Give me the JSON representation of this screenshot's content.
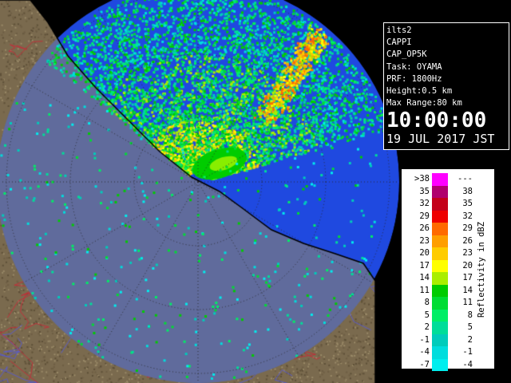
{
  "info": {
    "site": "ilts2",
    "product": "CAPPI",
    "product_code": "CAP_OP5K",
    "task": "Task: OYAMA",
    "prf": "PRF: 1800Hz",
    "height": "Height:0.5 km",
    "max_range": "Max Range:80 km",
    "time": "10:00:00",
    "date": "19 JUL 2017 JST"
  },
  "legend": {
    "unit_label": "Reflectivity in dBZ",
    "rows": [
      {
        "lo": ">38",
        "hi": "---",
        "color": "#ff00ff"
      },
      {
        "lo": "35",
        "hi": "38",
        "color": "#b0006e"
      },
      {
        "lo": "32",
        "hi": "35",
        "color": "#c4001a"
      },
      {
        "lo": "29",
        "hi": "32",
        "color": "#ee0000"
      },
      {
        "lo": "26",
        "hi": "29",
        "color": "#ff6a00"
      },
      {
        "lo": "23",
        "hi": "26",
        "color": "#ff9e00"
      },
      {
        "lo": "20",
        "hi": "23",
        "color": "#ffcc00"
      },
      {
        "lo": "17",
        "hi": "20",
        "color": "#ffff00"
      },
      {
        "lo": "14",
        "hi": "17",
        "color": "#aaee00"
      },
      {
        "lo": "11",
        "hi": "14",
        "color": "#00cc00"
      },
      {
        "lo": "8",
        "hi": "11",
        "color": "#00dd33"
      },
      {
        "lo": "5",
        "hi": "8",
        "color": "#00ee66"
      },
      {
        "lo": "2",
        "hi": "5",
        "color": "#00dd99"
      },
      {
        "lo": "-1",
        "hi": "2",
        "color": "#00ccbb"
      },
      {
        "lo": "-4",
        "hi": "-1",
        "color": "#00dddd"
      },
      {
        "lo": "-7",
        "hi": "-4",
        "color": "#00eeee"
      }
    ]
  },
  "colors": {
    "sea": "#1f49e0",
    "land": "#7a6a4e",
    "border": "#ffffff",
    "background": "#000000"
  }
}
